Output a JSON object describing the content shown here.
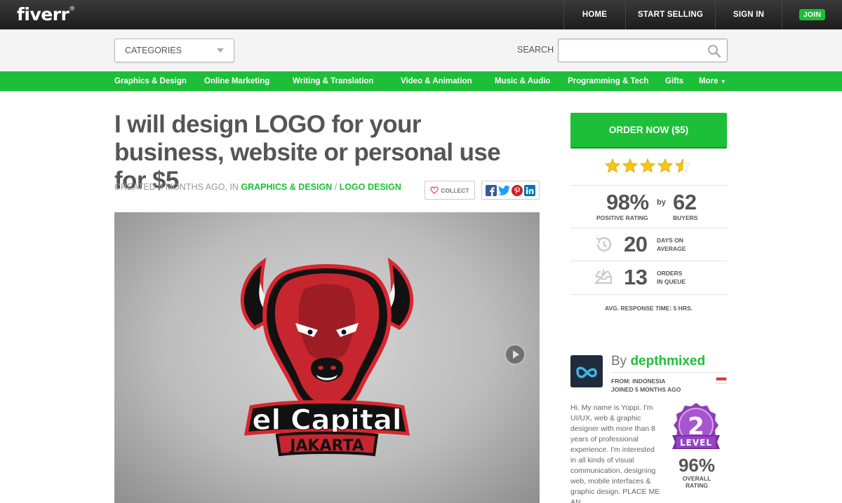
{
  "header": {
    "logo": "fiverr",
    "logo_mark": "®",
    "nav": {
      "home": "HOME",
      "start_selling": "START SELLING",
      "sign_in": "SIGN IN",
      "join": "JOIN"
    }
  },
  "search_bar": {
    "categories_label": "CATEGORIES",
    "search_label": "SEARCH",
    "search_value": ""
  },
  "category_nav": [
    "Graphics & Design",
    "Online Marketing",
    "Writing & Translation",
    "Video & Animation",
    "Music & Audio",
    "Programming & Tech",
    "Gifts",
    "More"
  ],
  "gig": {
    "title": "I will design LOGO for your business, website or personal use for $5",
    "created_prefix": "CREATED 4 MONTHS AGO, IN ",
    "category": "GRAPHICS & DESIGN",
    "separator": " / ",
    "subcategory": "LOGO DESIGN",
    "collect_label": "COLLECT",
    "share_icons": [
      "facebook-icon",
      "twitter-icon",
      "pinterest-icon",
      "linkedin-icon"
    ],
    "image_text": {
      "line1": "el Capital",
      "line2": "JAKARTA"
    }
  },
  "sidebar": {
    "order_button": "ORDER NOW ($5)",
    "rating_stars": 4.5,
    "positive_rating": "98%",
    "positive_rating_label": "POSITIVE RATING",
    "by": "by",
    "buyers": "62",
    "buyers_label": "BUYERS",
    "days": "20",
    "days_label_1": "DAYS ON",
    "days_label_2": "AVERAGE",
    "orders": "13",
    "orders_label_1": "ORDERS",
    "orders_label_2": "IN QUEUE",
    "response_time": "AVG. RESPONSE TIME: 5 HRS."
  },
  "seller": {
    "by_prefix": "By ",
    "username": "depthmixed",
    "from": "FROM: INDONESIA",
    "joined": "JOINED 5 MONTHS AGO",
    "bio": "Hi. My name is Yoppi. I'm UI/UX, web & graphic designer with more than 8 years of professional experience. I'm interested in all kinds of visual communication, designing web, mobile interfaces & graphic design. PLACE ME AN",
    "level_number": "2",
    "level_label": "LEVEL",
    "overall_rating": "96%",
    "overall_label_1": "OVERALL",
    "overall_label_2": "RATING"
  },
  "colors": {
    "brand_green": "#1dbf39",
    "topbar": "#222222",
    "level_purple": "#8e3fb5"
  }
}
